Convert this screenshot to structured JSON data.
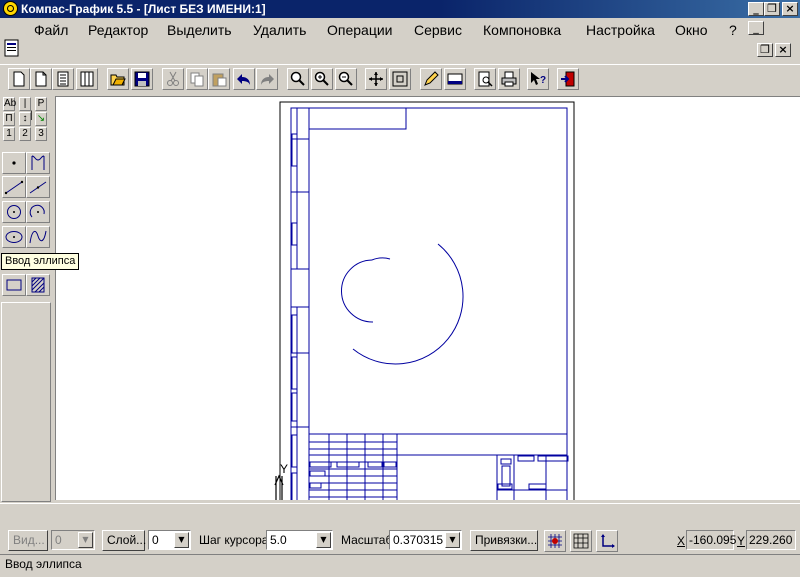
{
  "window": {
    "title": "Компас-График 5.5 - [Лист БЕЗ ИМЕНИ:1]",
    "minimize_glyph": "_",
    "restore_glyph": "❐",
    "close_glyph": "×"
  },
  "menu": {
    "items": [
      "Файл",
      "Редактор",
      "Выделить",
      "Удалить",
      "Операции",
      "Сервис",
      "Компоновка",
      "Настройка",
      "Окно",
      "?"
    ],
    "doc_restore_glyph": "❐",
    "doc_min_glyph": "_"
  },
  "tool_tabs": {
    "row1": [
      "Ab",
      "|—|",
      "P"
    ],
    "row2": [
      "П",
      "↕",
      "↘"
    ],
    "numbers": [
      "1",
      "2",
      "3"
    ]
  },
  "tooltip": "Ввод эллипса",
  "statusbar": {
    "view_button": "Вид...",
    "view_value": "0",
    "layer_button": "Слой...",
    "layer_value": "0",
    "cursor_step_label": "Шаг курсора",
    "cursor_step_value": "5.0",
    "scale_label": "Масштаб",
    "scale_value": "0.370315",
    "snaps_button": "Привязки...",
    "x_label": "X",
    "x_value": "-160.095",
    "y_label": "Y",
    "y_value": "229.260",
    "hint_text": "Ввод эллипса"
  },
  "drawing": {
    "y_axis_label": "Y"
  },
  "colors": {
    "titlebar": "#0a246a",
    "drawing_lines": "#0000a0",
    "tooltip_bg": "#ffffe1",
    "face": "#d4d0c8"
  }
}
